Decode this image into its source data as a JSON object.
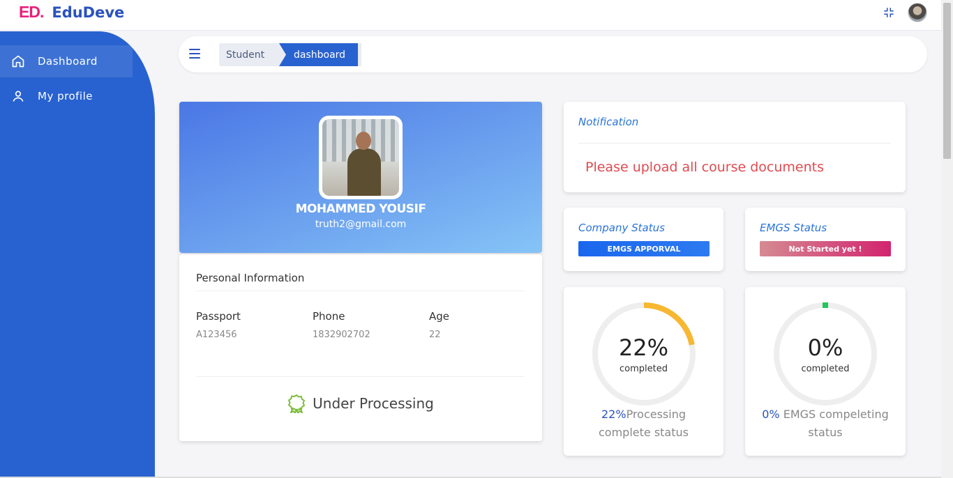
{
  "brand": {
    "mark": "ED",
    "dot": ".",
    "name": "EduDeve"
  },
  "header": {
    "compress_icon": "compress-icon",
    "avatar_alt": "user avatar"
  },
  "sidebar": {
    "items": [
      {
        "label": "Dashboard",
        "icon": "home-icon",
        "active": true
      },
      {
        "label": "My profile",
        "icon": "user-icon",
        "active": false
      }
    ]
  },
  "breadcrumb": {
    "items": [
      "Student",
      "dashboard"
    ]
  },
  "profile": {
    "name": "MOHAMMED YOUSIF",
    "email": "truth2@gmail.com"
  },
  "personal_info": {
    "title": "Personal Information",
    "fields": [
      {
        "label": "Passport",
        "value": "A123456"
      },
      {
        "label": "Phone",
        "value": "1832902702"
      },
      {
        "label": "Age",
        "value": "22"
      }
    ],
    "status": "Under Processing"
  },
  "notification": {
    "title": "Notification",
    "message": "Please upload all course documents"
  },
  "company_status": {
    "title": "Company Status",
    "badge": "EMGS APPORVAL"
  },
  "emgs_status": {
    "title": "EMGS Status",
    "badge": "Not Started yet !"
  },
  "progress_processing": {
    "percent_label": "22%",
    "value": 0.22,
    "sub": "completed",
    "caption_accent": "22%",
    "caption_rest": "Processing",
    "caption_line2": "complete status",
    "color": "#f7b731"
  },
  "progress_emgs": {
    "percent_label": "0%",
    "value": 0.0,
    "sub": "completed",
    "caption_accent": "0%",
    "caption_rest": " EMGS compeleting",
    "caption_line2": "status",
    "color": "#22c55e"
  },
  "colors": {
    "primary": "#2862d0",
    "notification_text": "#e04a50",
    "ring_track": "#eeeeee"
  }
}
